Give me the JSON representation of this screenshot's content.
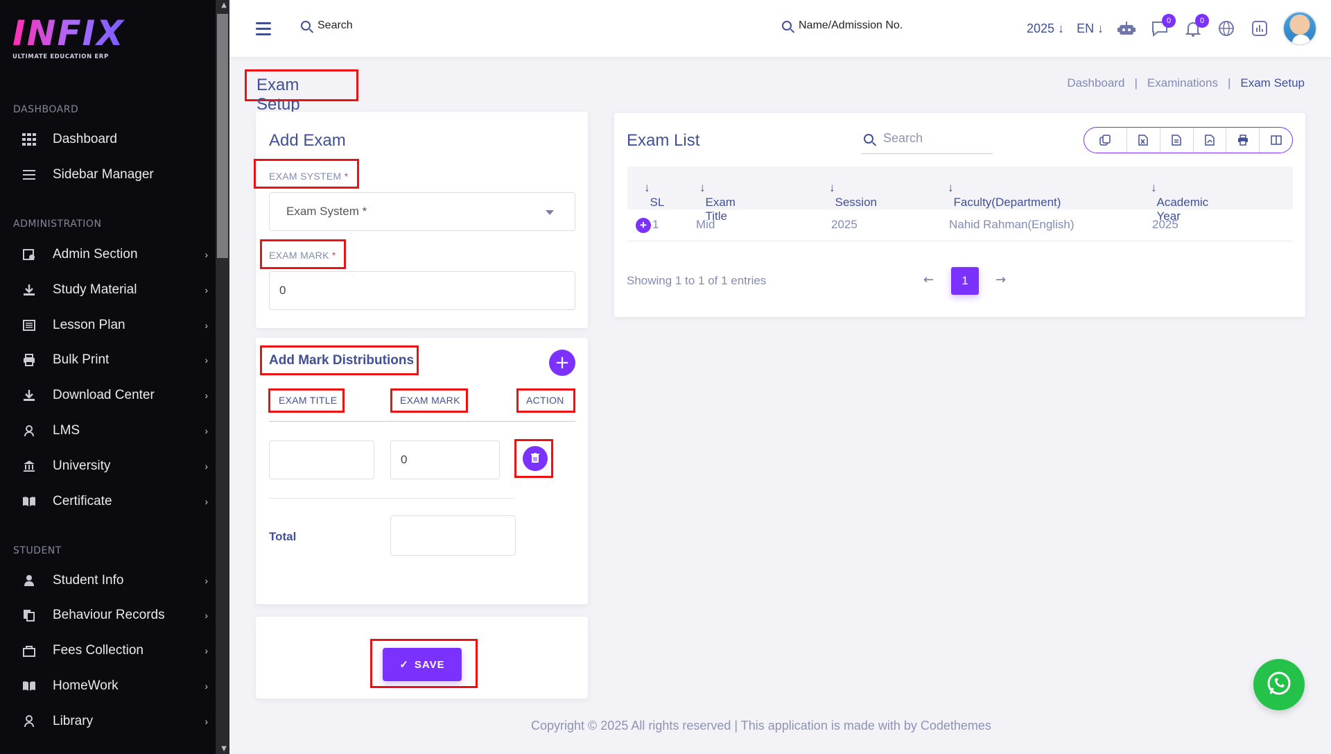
{
  "brand": {
    "logo_text": "INFIX",
    "tagline": "ULTIMATE EDUCATION ERP"
  },
  "sidebar": {
    "sections": [
      {
        "title": "DASHBOARD",
        "items": [
          {
            "label": "Dashboard",
            "icon": "grid-icon"
          },
          {
            "label": "Sidebar Manager",
            "icon": "menu-icon"
          }
        ]
      },
      {
        "title": "ADMINISTRATION",
        "items": [
          {
            "label": "Admin Section",
            "icon": "admin-icon"
          },
          {
            "label": "Study Material",
            "icon": "download-icon"
          },
          {
            "label": "Lesson Plan",
            "icon": "list-icon"
          },
          {
            "label": "Bulk Print",
            "icon": "printer-icon"
          },
          {
            "label": "Download Center",
            "icon": "download-icon"
          },
          {
            "label": "LMS",
            "icon": "lms-icon"
          },
          {
            "label": "University",
            "icon": "bank-icon"
          },
          {
            "label": "Certificate",
            "icon": "book-icon"
          }
        ]
      },
      {
        "title": "STUDENT",
        "items": [
          {
            "label": "Student Info",
            "icon": "user-icon"
          },
          {
            "label": "Behaviour Records",
            "icon": "records-icon"
          },
          {
            "label": "Fees Collection",
            "icon": "fees-icon"
          },
          {
            "label": "HomeWork",
            "icon": "book-icon"
          },
          {
            "label": "Library",
            "icon": "library-icon"
          }
        ]
      }
    ]
  },
  "topbar": {
    "search_label": "Search",
    "student_search_label": "Name/Admission No.",
    "year": "2025",
    "language": "EN",
    "chat_badge": "0",
    "notification_badge": "0"
  },
  "page": {
    "title": "Exam Setup",
    "breadcrumb": [
      "Dashboard",
      "Examinations",
      "Exam Setup"
    ]
  },
  "add_exam": {
    "title": "Add Exam",
    "exam_system_label": "EXAM SYSTEM",
    "exam_system_placeholder": "Exam System *",
    "exam_mark_label": "EXAM MARK",
    "exam_mark_value": "0",
    "required_marker": "*"
  },
  "mark_distribution": {
    "title": "Add Mark Distributions",
    "headers": [
      "EXAM TITLE",
      "EXAM MARK",
      "ACTION"
    ],
    "row": {
      "title_value": "",
      "mark_value": "0"
    },
    "total_label": "Total",
    "total_value": ""
  },
  "save_button": {
    "label": "SAVE",
    "icon": "check-icon"
  },
  "exam_list": {
    "title": "Exam List",
    "search_placeholder": "Search",
    "export_tools": [
      "copy-icon",
      "excel-icon",
      "csv-icon",
      "pdf-icon",
      "print-icon",
      "columns-icon"
    ],
    "columns": [
      "SL",
      "Exam Title",
      "Session",
      "Faculty(Department)",
      "Academic Year"
    ],
    "rows": [
      {
        "sl": "1",
        "exam_title": "Mid",
        "session": "2025",
        "faculty": "Nahid Rahman(English)",
        "academic_year": "2025"
      }
    ],
    "showing": "Showing 1 to 1 of 1 entries",
    "current_page": "1"
  },
  "footer": {
    "text": "Copyright © 2025 All rights reserved | This application is made with by Codethemes"
  }
}
